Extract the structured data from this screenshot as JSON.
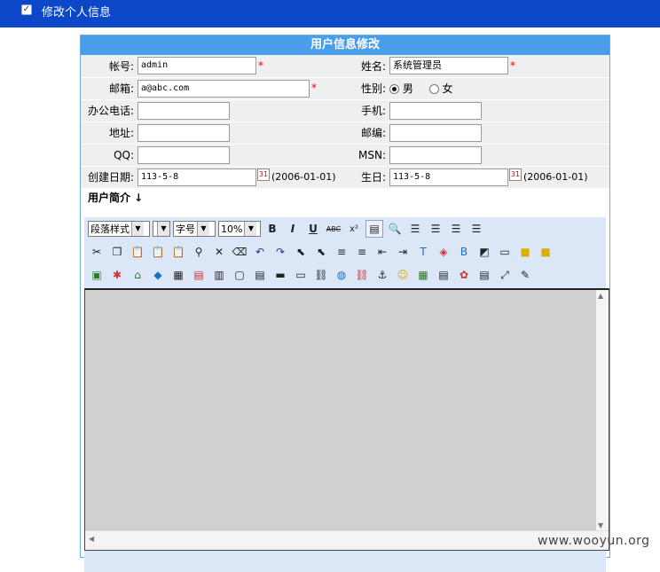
{
  "topbar": {
    "title": "修改个人信息",
    "icon": "checkbox-icon"
  },
  "panel": {
    "title": "用户信息修改"
  },
  "fields": {
    "account_label": "帐号:",
    "account_value": "admin",
    "name_label": "姓名:",
    "name_value": "系统管理员",
    "email_label": "邮箱:",
    "email_value": "a@abc.com",
    "gender_label": "性别:",
    "gender_male": "男",
    "gender_female": "女",
    "office_phone_label": "办公电话:",
    "mobile_label": "手机:",
    "address_label": "地址:",
    "zip_label": "邮编:",
    "qq_label": "QQ:",
    "msn_label": "MSN:",
    "created_label": "创建日期:",
    "created_value": "113-5-8",
    "created_hint": "(2006-01-01)",
    "birthday_label": "生日:",
    "birthday_value": "113-5-8",
    "birthday_hint": "(2006-01-01)",
    "required_mark": "*"
  },
  "intro": {
    "label": "用户简介 ↓"
  },
  "toolbar": {
    "paragraph_style": "段落样式",
    "font_size": "字号",
    "zoom": "10%",
    "bold": "B",
    "italic": "I",
    "underline": "U",
    "strike": "ABC",
    "superscript": "x²"
  },
  "watermark": "www.wooyun.org"
}
